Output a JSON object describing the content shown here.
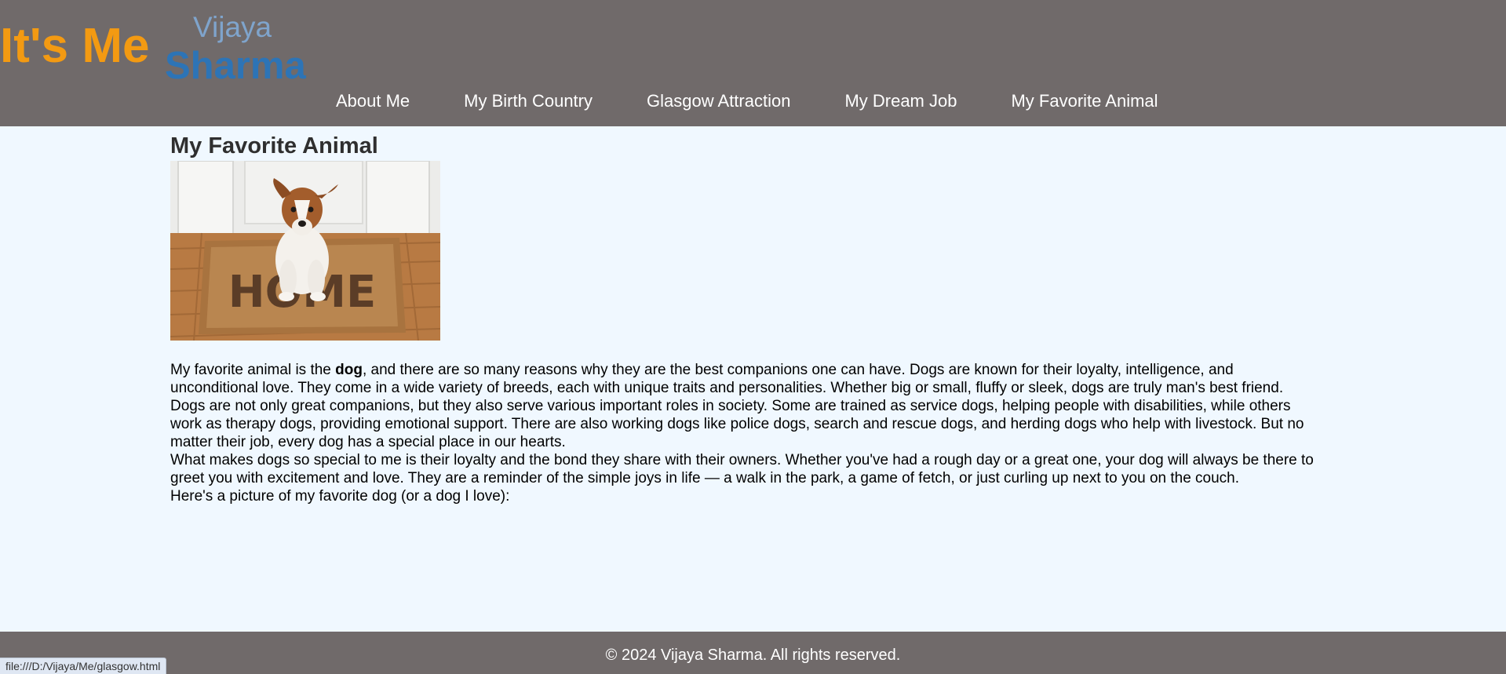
{
  "header": {
    "logo_main": "It's Me",
    "logo_first": "Vijaya",
    "logo_last": "Sharma"
  },
  "nav": [
    {
      "label": "About Me"
    },
    {
      "label": "My Birth Country"
    },
    {
      "label": "Glasgow Attraction"
    },
    {
      "label": "My Dream Job"
    },
    {
      "label": "My Favorite Animal"
    }
  ],
  "main": {
    "title": "My Favorite Animal",
    "image": {
      "mat_text": "HOME"
    },
    "p1_before": "My favorite animal is the ",
    "p1_bold": "dog",
    "p1_after": ", and there are so many reasons why they are the best companions one can have. Dogs are known for their loyalty, intelligence, and unconditional love. They come in a wide variety of breeds, each with unique traits and personalities. Whether big or small, fluffy or sleek, dogs are truly man's best friend.",
    "p2": "Dogs are not only great companions, but they also serve various important roles in society. Some are trained as service dogs, helping people with disabilities, while others work as therapy dogs, providing emotional support. There are also working dogs like police dogs, search and rescue dogs, and herding dogs who help with livestock. But no matter their job, every dog has a special place in our hearts.",
    "p3": "What makes dogs so special to me is their loyalty and the bond they share with their owners. Whether you've had a rough day or a great one, your dog will always be there to greet you with excitement and love. They are a reminder of the simple joys in life — a walk in the park, a game of fetch, or just curling up next to you on the couch.",
    "p4": "Here's a picture of my favorite dog (or a dog I love):"
  },
  "footer": {
    "text": "© 2024 Vijaya Sharma. All rights reserved."
  },
  "statusbar": {
    "url": "file:///D:/Vijaya/Me/glasgow.html"
  },
  "colors": {
    "header_bg": "#706a6a",
    "page_bg": "#f0f8ff",
    "logo_orange": "#f39a12",
    "logo_light_blue": "#7fa4cc",
    "logo_blue": "#2d74b6"
  }
}
